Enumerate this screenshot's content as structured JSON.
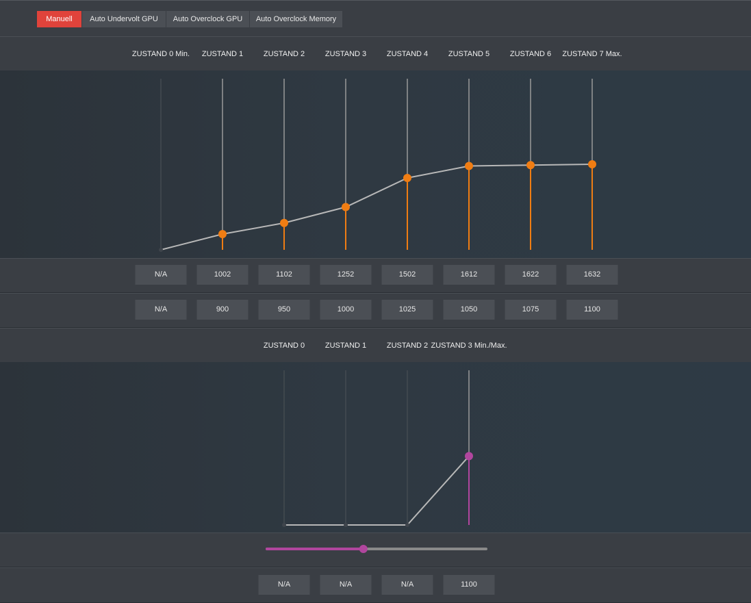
{
  "tabs": [
    {
      "label": "Manuell",
      "active": true
    },
    {
      "label": "Auto Undervolt GPU",
      "active": false
    },
    {
      "label": "Auto Overclock GPU",
      "active": false
    },
    {
      "label": "Auto Overclock Memory",
      "active": false
    }
  ],
  "gpu": {
    "states": [
      "ZUSTAND 0 Min.",
      "ZUSTAND 1",
      "ZUSTAND 2",
      "ZUSTAND 3",
      "ZUSTAND 4",
      "ZUSTAND 5",
      "ZUSTAND 6",
      "ZUSTAND 7 Max."
    ],
    "frequencies": [
      "N/A",
      "1002",
      "1102",
      "1252",
      "1502",
      "1612",
      "1622",
      "1632"
    ],
    "voltages": [
      "N/A",
      "900",
      "950",
      "1000",
      "1025",
      "1050",
      "1075",
      "1100"
    ],
    "active_color": "#f07d13",
    "curve_levels": [
      0,
      0.092,
      0.157,
      0.25,
      0.42,
      0.49,
      0.495,
      0.5
    ]
  },
  "memory": {
    "states": [
      "ZUSTAND 0",
      "ZUSTAND 1",
      "ZUSTAND 2",
      "ZUSTAND 3 Min./Max."
    ],
    "values": [
      "N/A",
      "N/A",
      "N/A",
      "1100"
    ],
    "active_color": "#b1469e",
    "curve_levels": [
      0,
      0,
      0,
      0.445
    ],
    "slider_fraction": 0.44
  }
}
